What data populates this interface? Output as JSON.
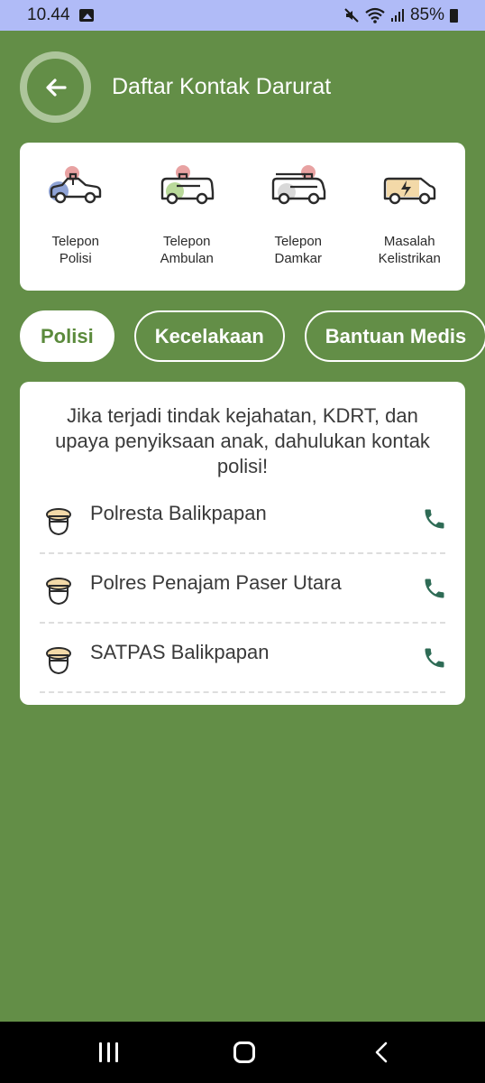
{
  "status_bar": {
    "time": "10.44",
    "battery": "85%"
  },
  "header": {
    "title": "Daftar Kontak Darurat"
  },
  "categories": [
    {
      "label": "Telepon\nPolisi",
      "icon": "police-car-icon",
      "accent": "#8fa3d6"
    },
    {
      "label": "Telepon\nAmbulan",
      "icon": "ambulance-icon",
      "accent": "#b9d99a"
    },
    {
      "label": "Telepon\nDamkar",
      "icon": "fire-truck-icon",
      "accent": "#d9d9d9"
    },
    {
      "label": "Masalah\nKelistrikan",
      "icon": "electric-van-icon",
      "accent": "#f3d9a8"
    }
  ],
  "tabs": [
    {
      "label": "Polisi",
      "active": true
    },
    {
      "label": "Kecelakaan",
      "active": false
    },
    {
      "label": "Bantuan Medis",
      "active": false
    }
  ],
  "intro_text": "Jika terjadi tindak kejahatan, KDRT, dan upaya penyiksaan anak, dahulukan kontak polisi!",
  "contacts": [
    {
      "name": "Polresta Balikpapan",
      "icon": "police-officer-icon"
    },
    {
      "name": "Polres Penajam Paser Utara",
      "icon": "police-officer-icon"
    },
    {
      "name": "SATPAS Balikpapan",
      "icon": "police-officer-icon"
    }
  ],
  "colors": {
    "background": "#638e47",
    "status_bar": "#b0bbf7",
    "active_tab_text": "#5b8a3c",
    "phone_icon": "#2e6b55",
    "siren": "#e8a2a2"
  }
}
